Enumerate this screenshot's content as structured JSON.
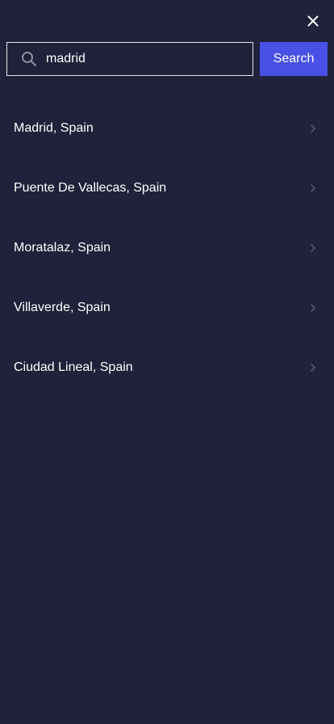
{
  "search": {
    "value": "madrid",
    "button_label": "Search"
  },
  "results": [
    {
      "label": "Madrid, Spain"
    },
    {
      "label": "Puente De Vallecas, Spain"
    },
    {
      "label": "Moratalaz, Spain"
    },
    {
      "label": "Villaverde, Spain"
    },
    {
      "label": "Ciudad Lineal, Spain"
    }
  ],
  "icons": {
    "close": "close-icon",
    "search": "search-icon",
    "chevron": "chevron-right-icon"
  },
  "colors": {
    "background": "#20213a",
    "accent": "#4850e6",
    "text": "#ffffff",
    "chevron": "#5b5c72",
    "search_icon": "#8b8c9c"
  }
}
